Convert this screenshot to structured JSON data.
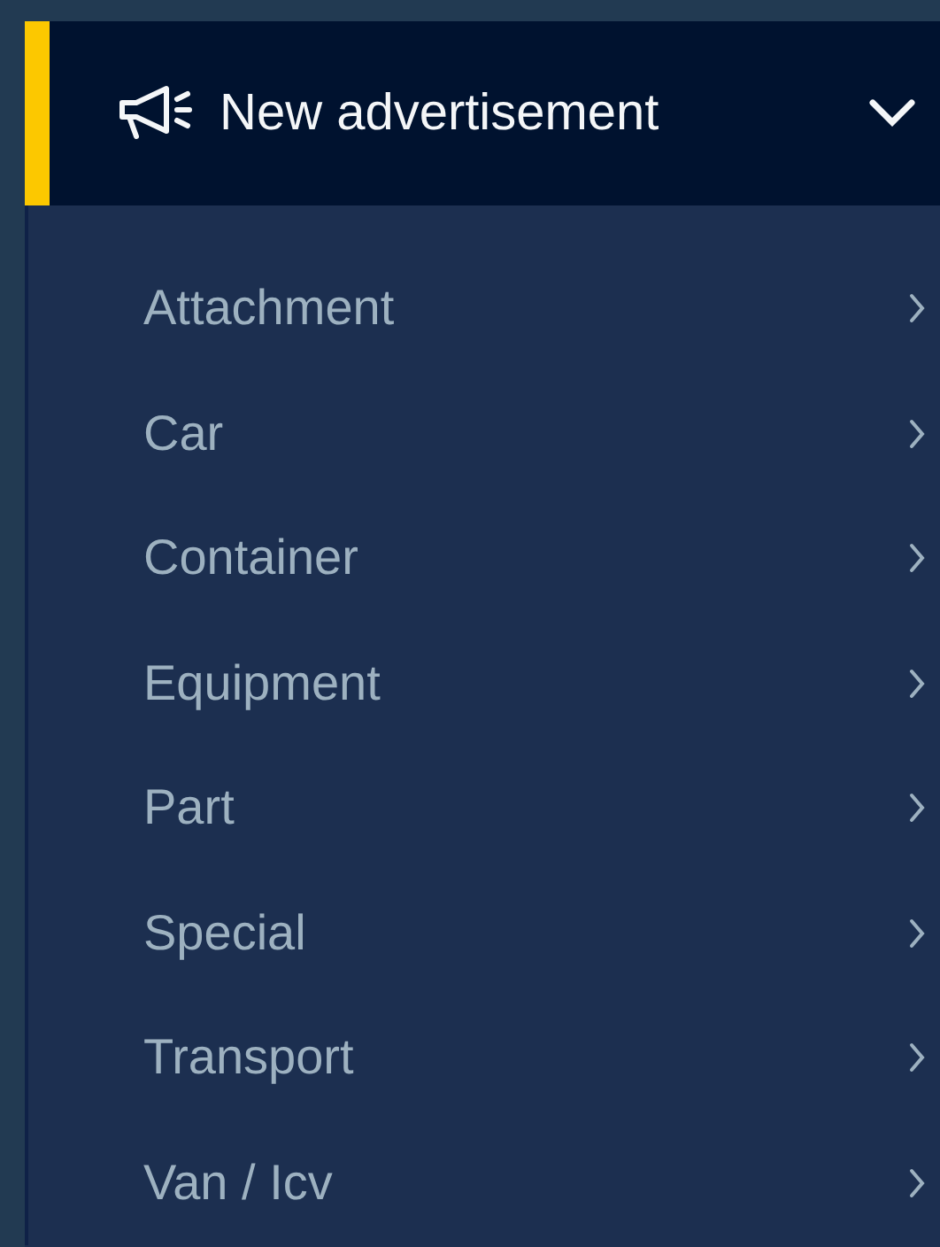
{
  "menu": {
    "title": "New advertisement",
    "expanded": true,
    "items": [
      {
        "label": "Attachment"
      },
      {
        "label": "Car"
      },
      {
        "label": "Container"
      },
      {
        "label": "Equipment"
      },
      {
        "label": "Part"
      },
      {
        "label": "Special"
      },
      {
        "label": "Transport"
      },
      {
        "label": "Van / Icv"
      }
    ]
  }
}
